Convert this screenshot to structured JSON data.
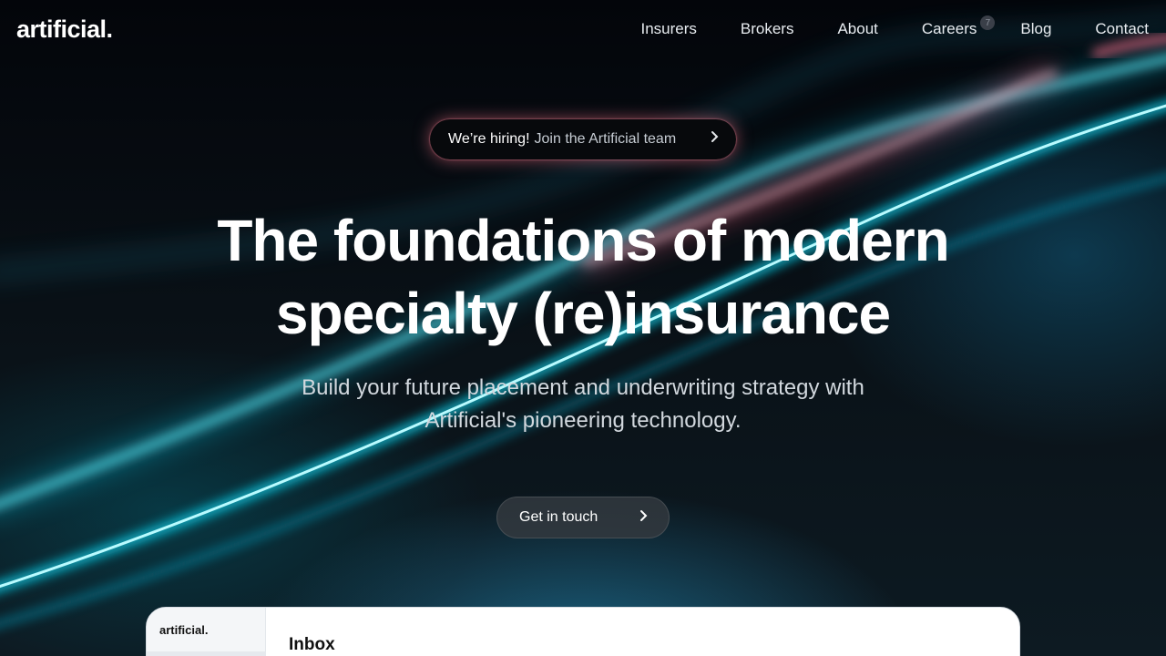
{
  "brand": {
    "logo": "artificial."
  },
  "nav": {
    "items": [
      {
        "label": "Insurers"
      },
      {
        "label": "Brokers"
      },
      {
        "label": "About"
      },
      {
        "label": "Careers",
        "badge": "7"
      },
      {
        "label": "Blog"
      },
      {
        "label": "Contact"
      }
    ]
  },
  "hiring": {
    "strong": "We’re hiring!",
    "link": "Join the Artificial team"
  },
  "hero": {
    "line1": "The foundations of modern",
    "line2": "specialty (re)insurance",
    "sub1": "Build your future placement and underwriting strategy with",
    "sub2": "Artificial's pioneering technology."
  },
  "cta": {
    "label": "Get in touch"
  },
  "app_preview": {
    "logo": "artificial.",
    "title": "Inbox"
  },
  "colors": {
    "accent_pink": "#ff7a90",
    "accent_cyan": "#18e6ff",
    "background": "#04060a"
  }
}
